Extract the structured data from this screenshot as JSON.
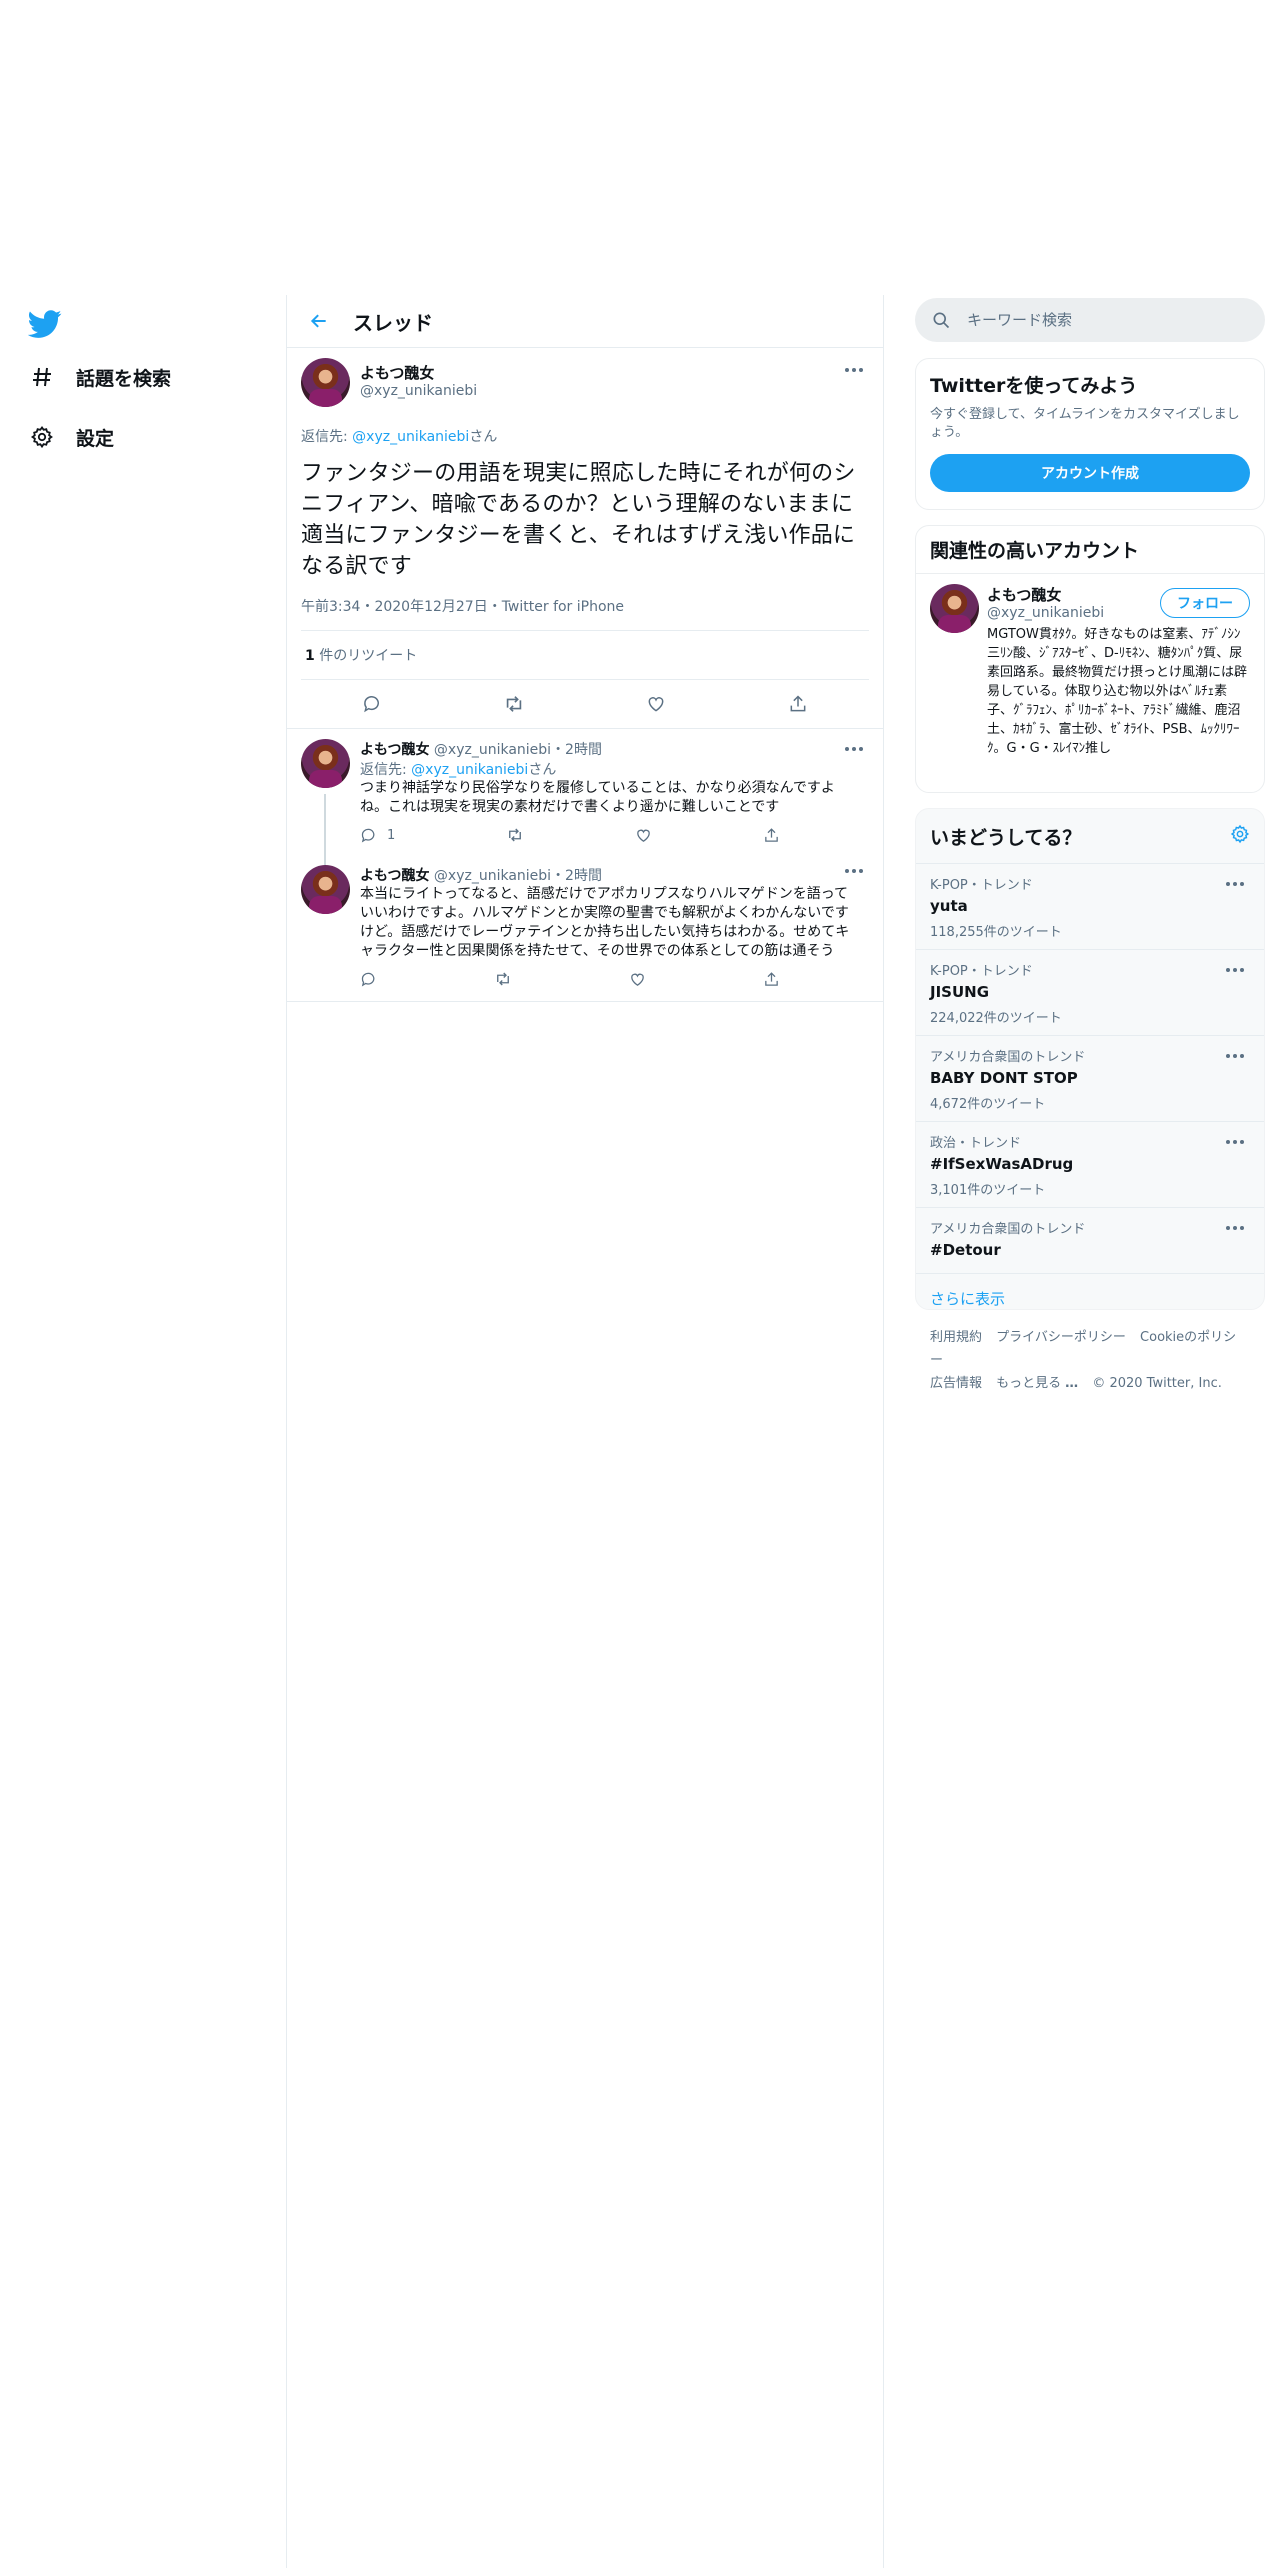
{
  "nav": {
    "explore_label": "話題を検索",
    "settings_label": "設定"
  },
  "header": {
    "title": "スレッド"
  },
  "main_tweet": {
    "name": "よもつ醜女",
    "handle": "@xyz_unikaniebi",
    "reply_prefix": "返信先: ",
    "reply_handle": "@xyz_unikaniebi",
    "reply_suffix": "さん",
    "text": "ファンタジーの用語を現実に照応した時にそれが何のシニフィアン、暗喩であるのか？という理解のないままに適当にファンタジーを書くと、それはすげえ浅い作品になる訳です",
    "meta": "午前3:34・2020年12月27日・Twitter for iPhone",
    "retweet_count": "1",
    "retweet_label": "件のリツイート"
  },
  "replies": [
    {
      "name": "よもつ醜女",
      "handle": "@xyz_unikaniebi",
      "time": "・2時間",
      "reply_prefix": "返信先: ",
      "reply_handle": "@xyz_unikaniebi",
      "reply_suffix": "さん",
      "text": "つまり神話学なり民俗学なりを履修していることは、かなり必須なんですよね。これは現実を現実の素材だけで書くより遥かに難しいことです",
      "reply_count": "1"
    },
    {
      "name": "よもつ醜女",
      "handle": "@xyz_unikaniebi",
      "time": "・2時間",
      "text": "本当にライトってなると、語感だけでアポカリプスなりハルマゲドンを語っていいわけですよ。ハルマゲドンとか実際の聖書でも解釈がよくわかんないですけど。語感だけでレーヴァテインとか持ち出したい気持ちはわかる。せめてキャラクター性と因果関係を持たせて、その世界での体系としての筋は通そう"
    }
  ],
  "search": {
    "placeholder": "キーワード検索"
  },
  "signup": {
    "title": "Twitterを使ってみよう",
    "subtitle": "今すぐ登録して、タイムラインをカスタマイズしましょう。",
    "button": "アカウント作成"
  },
  "related": {
    "title": "関連性の高いアカウント",
    "name": "よもつ醜女",
    "handle": "@xyz_unikaniebi",
    "follow": "フォロー",
    "bio": "MGTOW貫ｵﾀｸ。好きなものは窒素、ｱﾃﾞﾉｼﾝ三ﾘﾝ酸、ｼﾞｱｽﾀｰｾﾞ、D-ﾘﾓﾈﾝ、糖ﾀﾝﾊﾟｸ質、尿素回路系。最終物質だけ摂っとけ風潮には辟易している。体取り込む物以外はﾍﾞﾙﾁｪ素子、ｸﾞﾗﾌｪﾝ、ﾎﾟﾘｶｰﾎﾞﾈｰﾄ、ｱﾗﾐﾄﾞ繊維、鹿沼土、ｶｷｶﾞﾗ、富士砂、ｾﾞｵﾗｲﾄ、PSB、ﾑｯｸﾘﾜｰｸ。G・G・ｽﾚｲﾏﾝ推し"
  },
  "trends": {
    "title": "いまどうしてる？",
    "items": [
      {
        "meta": "K-POP・トレンド",
        "name": "yuta",
        "count": "118,255件のツイート"
      },
      {
        "meta": "K-POP・トレンド",
        "name": "JISUNG",
        "count": "224,022件のツイート"
      },
      {
        "meta": "アメリカ合衆国のトレンド",
        "name": "BABY DONT STOP",
        "count": "4,672件のツイート"
      },
      {
        "meta": "政治・トレンド",
        "name": "#IfSexWasADrug",
        "count": "3,101件のツイート"
      },
      {
        "meta": "アメリカ合衆国のトレンド",
        "name": "#Detour",
        "count": ""
      }
    ],
    "show_more": "さらに表示"
  },
  "footer": {
    "terms": "利用規約",
    "privacy": "プライバシーポリシー",
    "cookie": "Cookieのポリシー",
    "ads": "広告情報",
    "more": "もっと見る",
    "copyright": "© 2020 Twitter, Inc."
  },
  "colors": {
    "accent": "#1da1f2",
    "text": "#0f1419",
    "secondary": "#5b7083",
    "border": "#e6ecf0"
  }
}
